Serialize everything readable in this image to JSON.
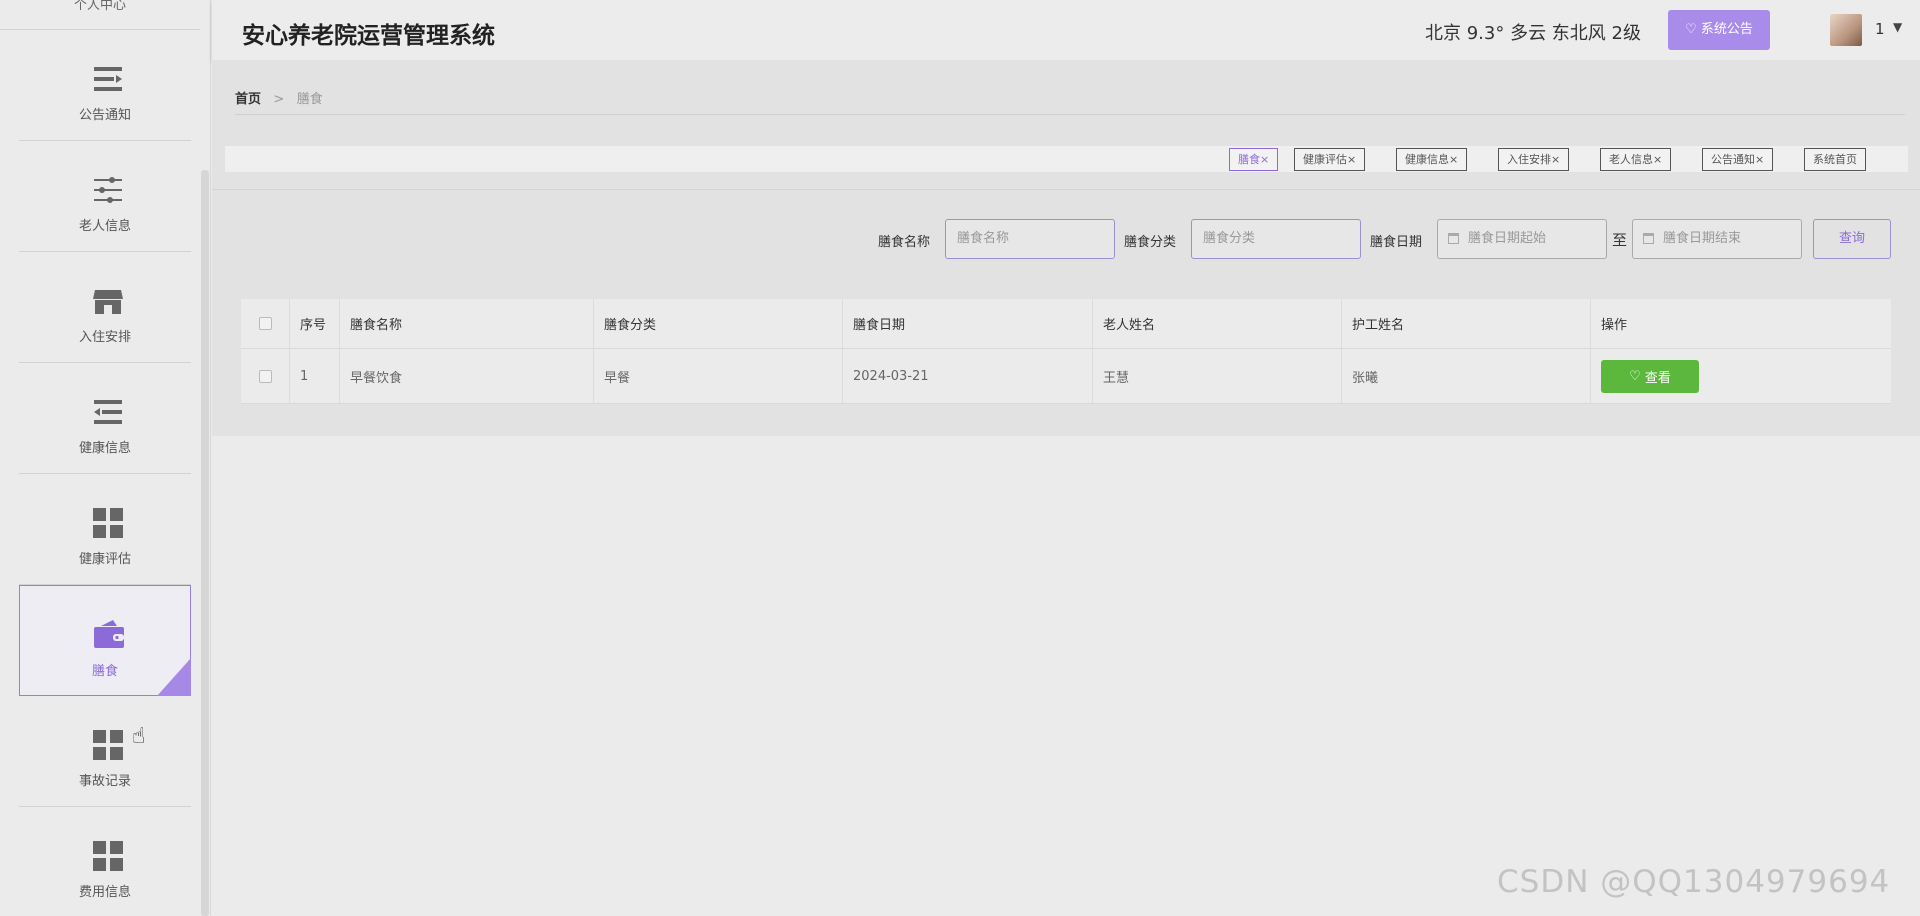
{
  "app": {
    "title": "安心养老院运营管理系统"
  },
  "header": {
    "weather": "北京 9.3° 多云 东北风 2级",
    "notice_button": "系统公告",
    "user": "1"
  },
  "sidebar": {
    "top_label": "个人中心",
    "items": [
      {
        "label": "公告通知",
        "icon": "list-icon"
      },
      {
        "label": "老人信息",
        "icon": "sliders-icon"
      },
      {
        "label": "入住安排",
        "icon": "store-icon"
      },
      {
        "label": "健康信息",
        "icon": "indent-list-icon"
      },
      {
        "label": "健康评估",
        "icon": "grid-icon"
      },
      {
        "label": "膳食",
        "icon": "wallet-icon",
        "active": true
      },
      {
        "label": "事故记录",
        "icon": "grid-icon"
      },
      {
        "label": "费用信息",
        "icon": "grid-icon"
      }
    ]
  },
  "breadcrumb": {
    "home": "首页",
    "sep": ">",
    "current": "膳食"
  },
  "tabs": [
    {
      "label": "膳食×",
      "active": true
    },
    {
      "label": "健康评估×"
    },
    {
      "label": "健康信息×"
    },
    {
      "label": "入住安排×"
    },
    {
      "label": "老人信息×"
    },
    {
      "label": "公告通知×"
    },
    {
      "label": "系统首页"
    }
  ],
  "search": {
    "name_label": "膳食名称",
    "name_placeholder": "膳食名称",
    "category_label": "膳食分类",
    "category_placeholder": "膳食分类",
    "date_label": "膳食日期",
    "date_start_placeholder": "膳食日期起始",
    "to_label": "至",
    "date_end_placeholder": "膳食日期结束",
    "query_button": "查询"
  },
  "table": {
    "headers": [
      "序号",
      "膳食名称",
      "膳食分类",
      "膳食日期",
      "老人姓名",
      "护工姓名",
      "操作"
    ],
    "rows": [
      [
        "1",
        "早餐饮食",
        "早餐",
        "2024-03-21",
        "王慧",
        "张曦"
      ]
    ],
    "view_button": "查看"
  },
  "watermark": "CSDN @QQ1304979694",
  "colors": {
    "accent": "#a98bea",
    "view_button": "#5bb83d"
  }
}
